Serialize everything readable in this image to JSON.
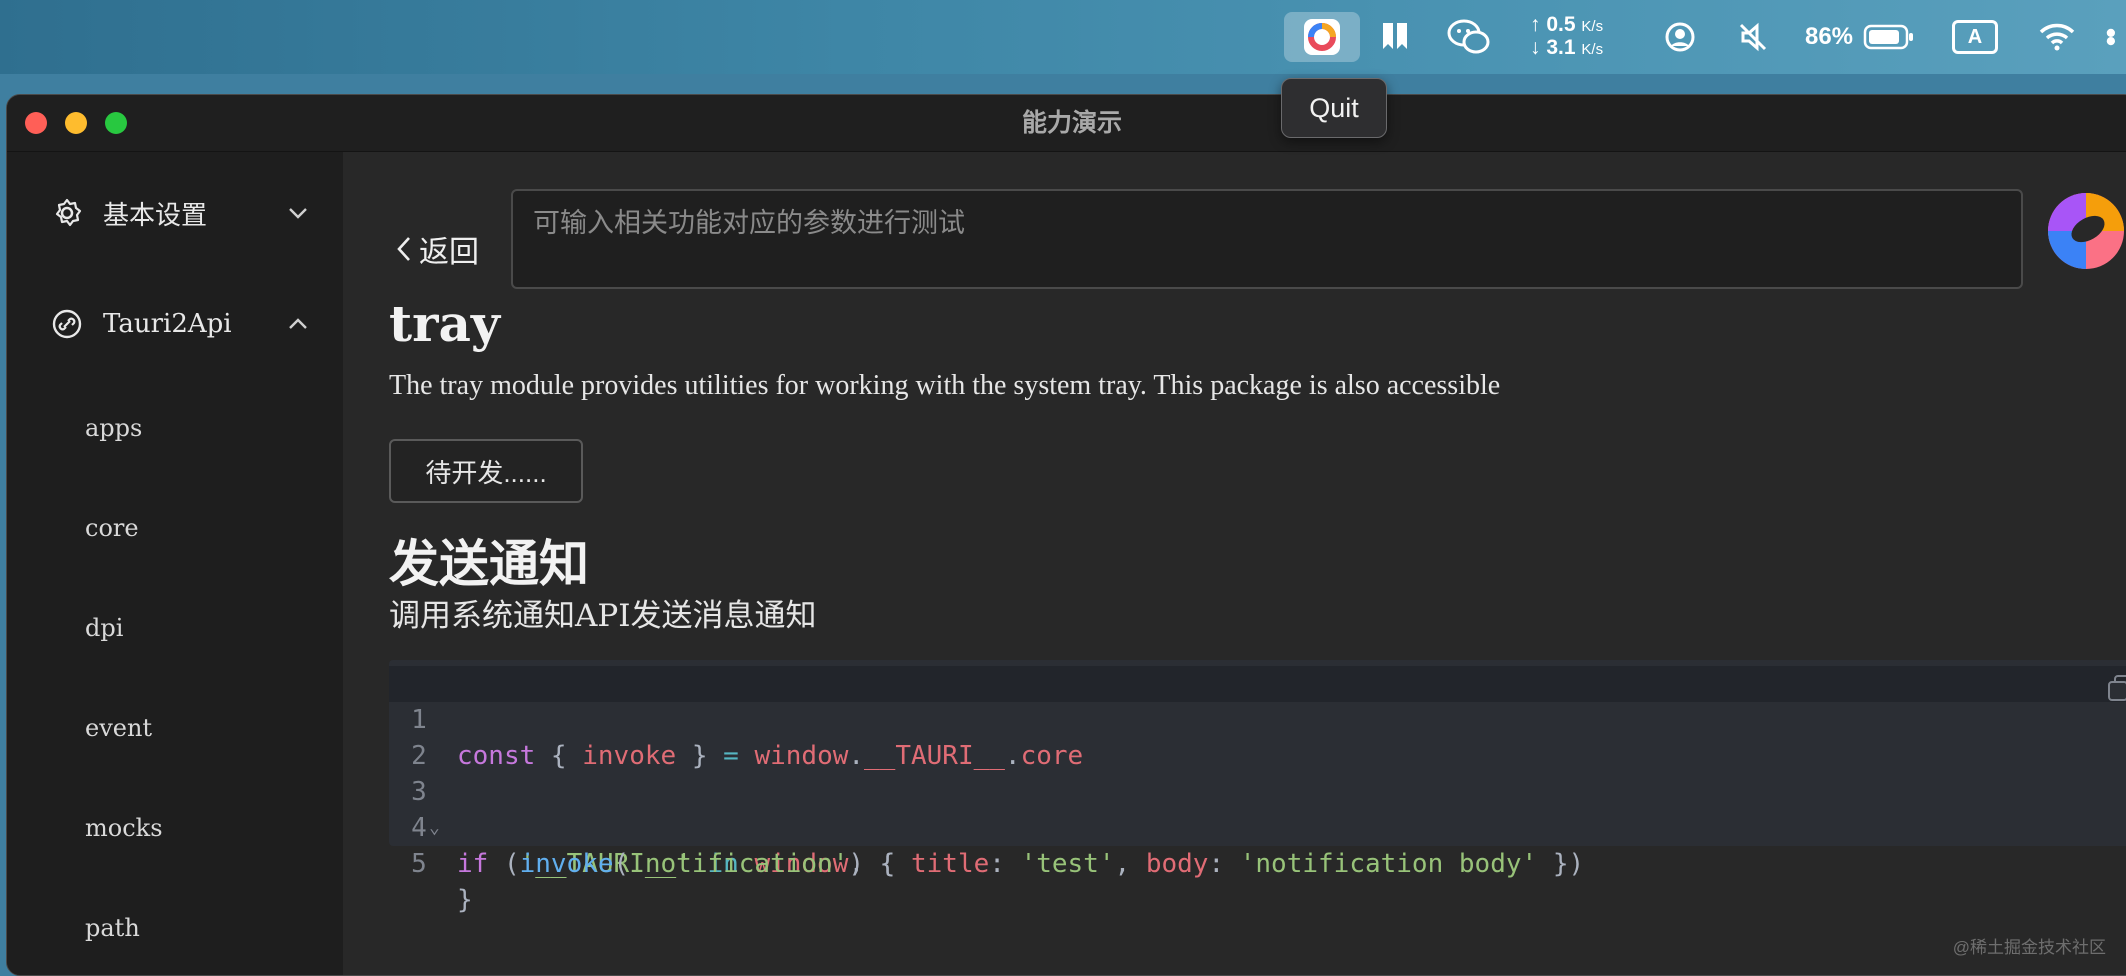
{
  "menubar": {
    "net_up": "0.5",
    "net_down": "3.1",
    "net_unit": "K/s",
    "battery_percent": "86%",
    "input_source": "A",
    "tooltip": "Quit"
  },
  "window": {
    "title": "能力演示"
  },
  "sidebar": {
    "sections": [
      {
        "label": "基本设置",
        "expanded": false
      },
      {
        "label": "Tauri2Api",
        "expanded": true
      }
    ],
    "items": [
      "apps",
      "core",
      "dpi",
      "event",
      "mocks",
      "path"
    ]
  },
  "main": {
    "back_label": "返回",
    "input_placeholder": "可输入相关功能对应的参数进行测试",
    "tray": {
      "title": "tray",
      "description": "The tray module provides utilities for working with the system tray. This package is also accessible",
      "button": "待开发......"
    },
    "notification": {
      "title": "发送通知",
      "description": "调用系统通知API发送消息通知"
    },
    "code": {
      "line_numbers": [
        "1",
        "2",
        "3",
        "4",
        "5"
      ],
      "lines": [
        "const { invoke } = window.__TAURI__.core",
        "",
        "if ('__TAURI__' in window) {",
        "    invoke('notification', { title: 'test', body: 'notification body' })",
        "}"
      ]
    }
  },
  "watermark": "@稀土掘金技术社区",
  "colors": {
    "window_bg": "#282828",
    "sidebar_bg": "#1e1e1e",
    "titlebar_bg": "#1f1f1f",
    "code_bg": "#2b2e34",
    "keyword": "#c678dd",
    "identifier": "#e06c75",
    "string": "#98c379",
    "function": "#61afef"
  }
}
